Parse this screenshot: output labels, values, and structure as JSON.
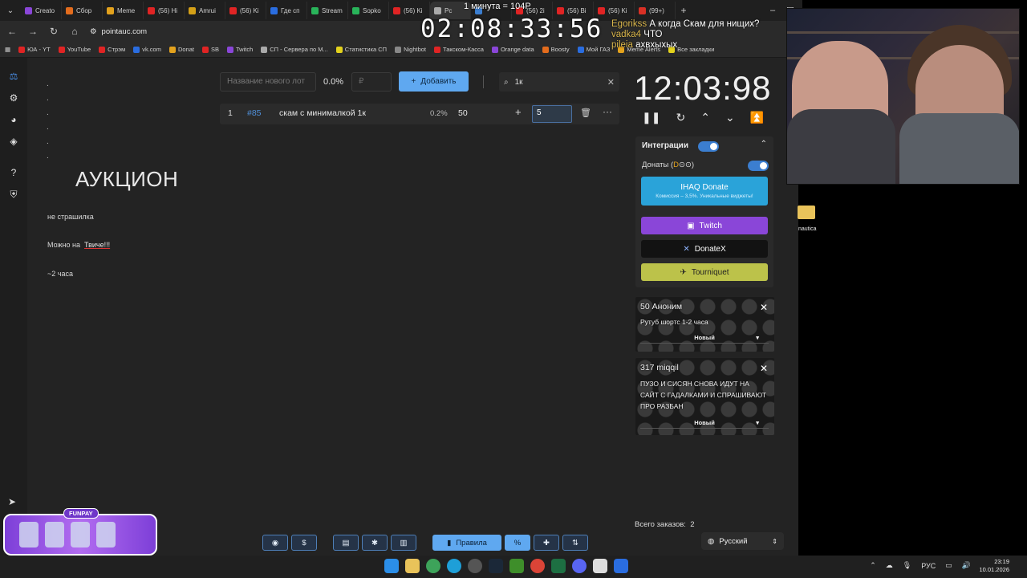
{
  "browser": {
    "tabs": [
      {
        "label": "Creato",
        "color": "#8a46d8"
      },
      {
        "label": "Сбор",
        "color": "#e36c1d"
      },
      {
        "label": "Meme",
        "color": "#e3a21d"
      },
      {
        "label": "(56) Hi",
        "color": "#e02424"
      },
      {
        "label": "Amrui",
        "color": "#d4a017"
      },
      {
        "label": "(56) Ki",
        "color": "#e02424"
      },
      {
        "label": "Где сп",
        "color": "#2a6de0"
      },
      {
        "label": "Stream",
        "color": "#29b45a"
      },
      {
        "label": "Sopko",
        "color": "#29b45a"
      },
      {
        "label": "(56) Ki",
        "color": "#e02424"
      },
      {
        "label": "Pc",
        "color": "#aaaaaa"
      },
      {
        "label": "",
        "color": "#3b7ed0"
      },
      {
        "label": "(56) 2i",
        "color": "#e02424"
      },
      {
        "label": "(56) Bi",
        "color": "#e02424"
      },
      {
        "label": "(56) Ki",
        "color": "#e02424"
      },
      {
        "label": "(99+)",
        "color": "#d93025"
      }
    ],
    "url": "pointauc.com",
    "bookmarks": [
      {
        "label": "ЮА - YT",
        "color": "#e02424"
      },
      {
        "label": "YouTube",
        "color": "#e02424"
      },
      {
        "label": "Стрэм",
        "color": "#e02424"
      },
      {
        "label": "vk.com",
        "color": "#2a6de0"
      },
      {
        "label": "Donat",
        "color": "#e3a21d"
      },
      {
        "label": "SB",
        "color": "#e02424"
      },
      {
        "label": "Twitch",
        "color": "#8a46d8"
      },
      {
        "label": "СП - Сервера по М...",
        "color": "#aaaaaa"
      },
      {
        "label": "Статистика СП",
        "color": "#e3d21d"
      },
      {
        "label": "Nightbot",
        "color": "#888888"
      },
      {
        "label": "Такском-Касса",
        "color": "#e02424"
      },
      {
        "label": "Orange data",
        "color": "#8a46d8"
      },
      {
        "label": "Boosty",
        "color": "#e36c1d"
      },
      {
        "label": "Мой ГАЗ",
        "color": "#2a6de0"
      },
      {
        "label": "Meme Alerts",
        "color": "#e3a21d"
      },
      {
        "label": "Все закладки",
        "color": "#e3d21d"
      }
    ]
  },
  "overlay": {
    "reward_line": "1 минута = 104Р",
    "big_clock": "02:08:33:56",
    "chat": [
      {
        "user": "Egorikss",
        "msg": "А когда Скам для нищих?"
      },
      {
        "user": "vadka4",
        "msg": "ЧТО"
      },
      {
        "user": "pileia",
        "msg": "ахвхыхых"
      }
    ],
    "desktop_label": "nautica"
  },
  "auction": {
    "title": "АУКЦИОН",
    "notes": [
      "не страшилка",
      "Можно на",
      "Твиче!!!",
      "~2 часа"
    ],
    "new_lot_placeholder": "Название нового лот",
    "total_pct": "0.0%",
    "amount_placeholder": "₽",
    "add_label": "Добавить",
    "search_value": "1к",
    "lots": [
      {
        "idx": "1",
        "num": "#85",
        "name": "скам с минималкой 1к",
        "pct": "0.2%",
        "amount": "50",
        "input": "5"
      }
    ]
  },
  "panel": {
    "timer": "12:03:98",
    "integrations_label": "Интеграции",
    "donations_label": "Донаты (",
    "ihaq_label": "IHAQ Donate",
    "ihaq_sub": "Комиссия – 3,5%. Уникальные виджеты!",
    "twitch_label": "Twitch",
    "donatex_label": "DonateX",
    "tourniquet_label": "Tourniquet",
    "donations": [
      {
        "head": "50 Аноним",
        "message": "Рутуб шортс 1-2 часа",
        "status": "Новый"
      },
      {
        "head": "317 miqqil",
        "message": "ПУЗО И СИСЯН СНОВА ИДУТ НА САЙТ С ГАДАЛКАМИ И СПРАШИВАЮТ ПРО РАЗБАН",
        "status": "Новый"
      }
    ],
    "orders_label": "Всего заказов:",
    "orders_count": "2",
    "language": "Русский"
  },
  "bottom_bar": {
    "rules_label": "Правила"
  },
  "promo": {
    "tag": "FUNPAY"
  },
  "taskbar": {
    "lang": "РУС",
    "time": "23:19",
    "date": "10.01.2026"
  }
}
